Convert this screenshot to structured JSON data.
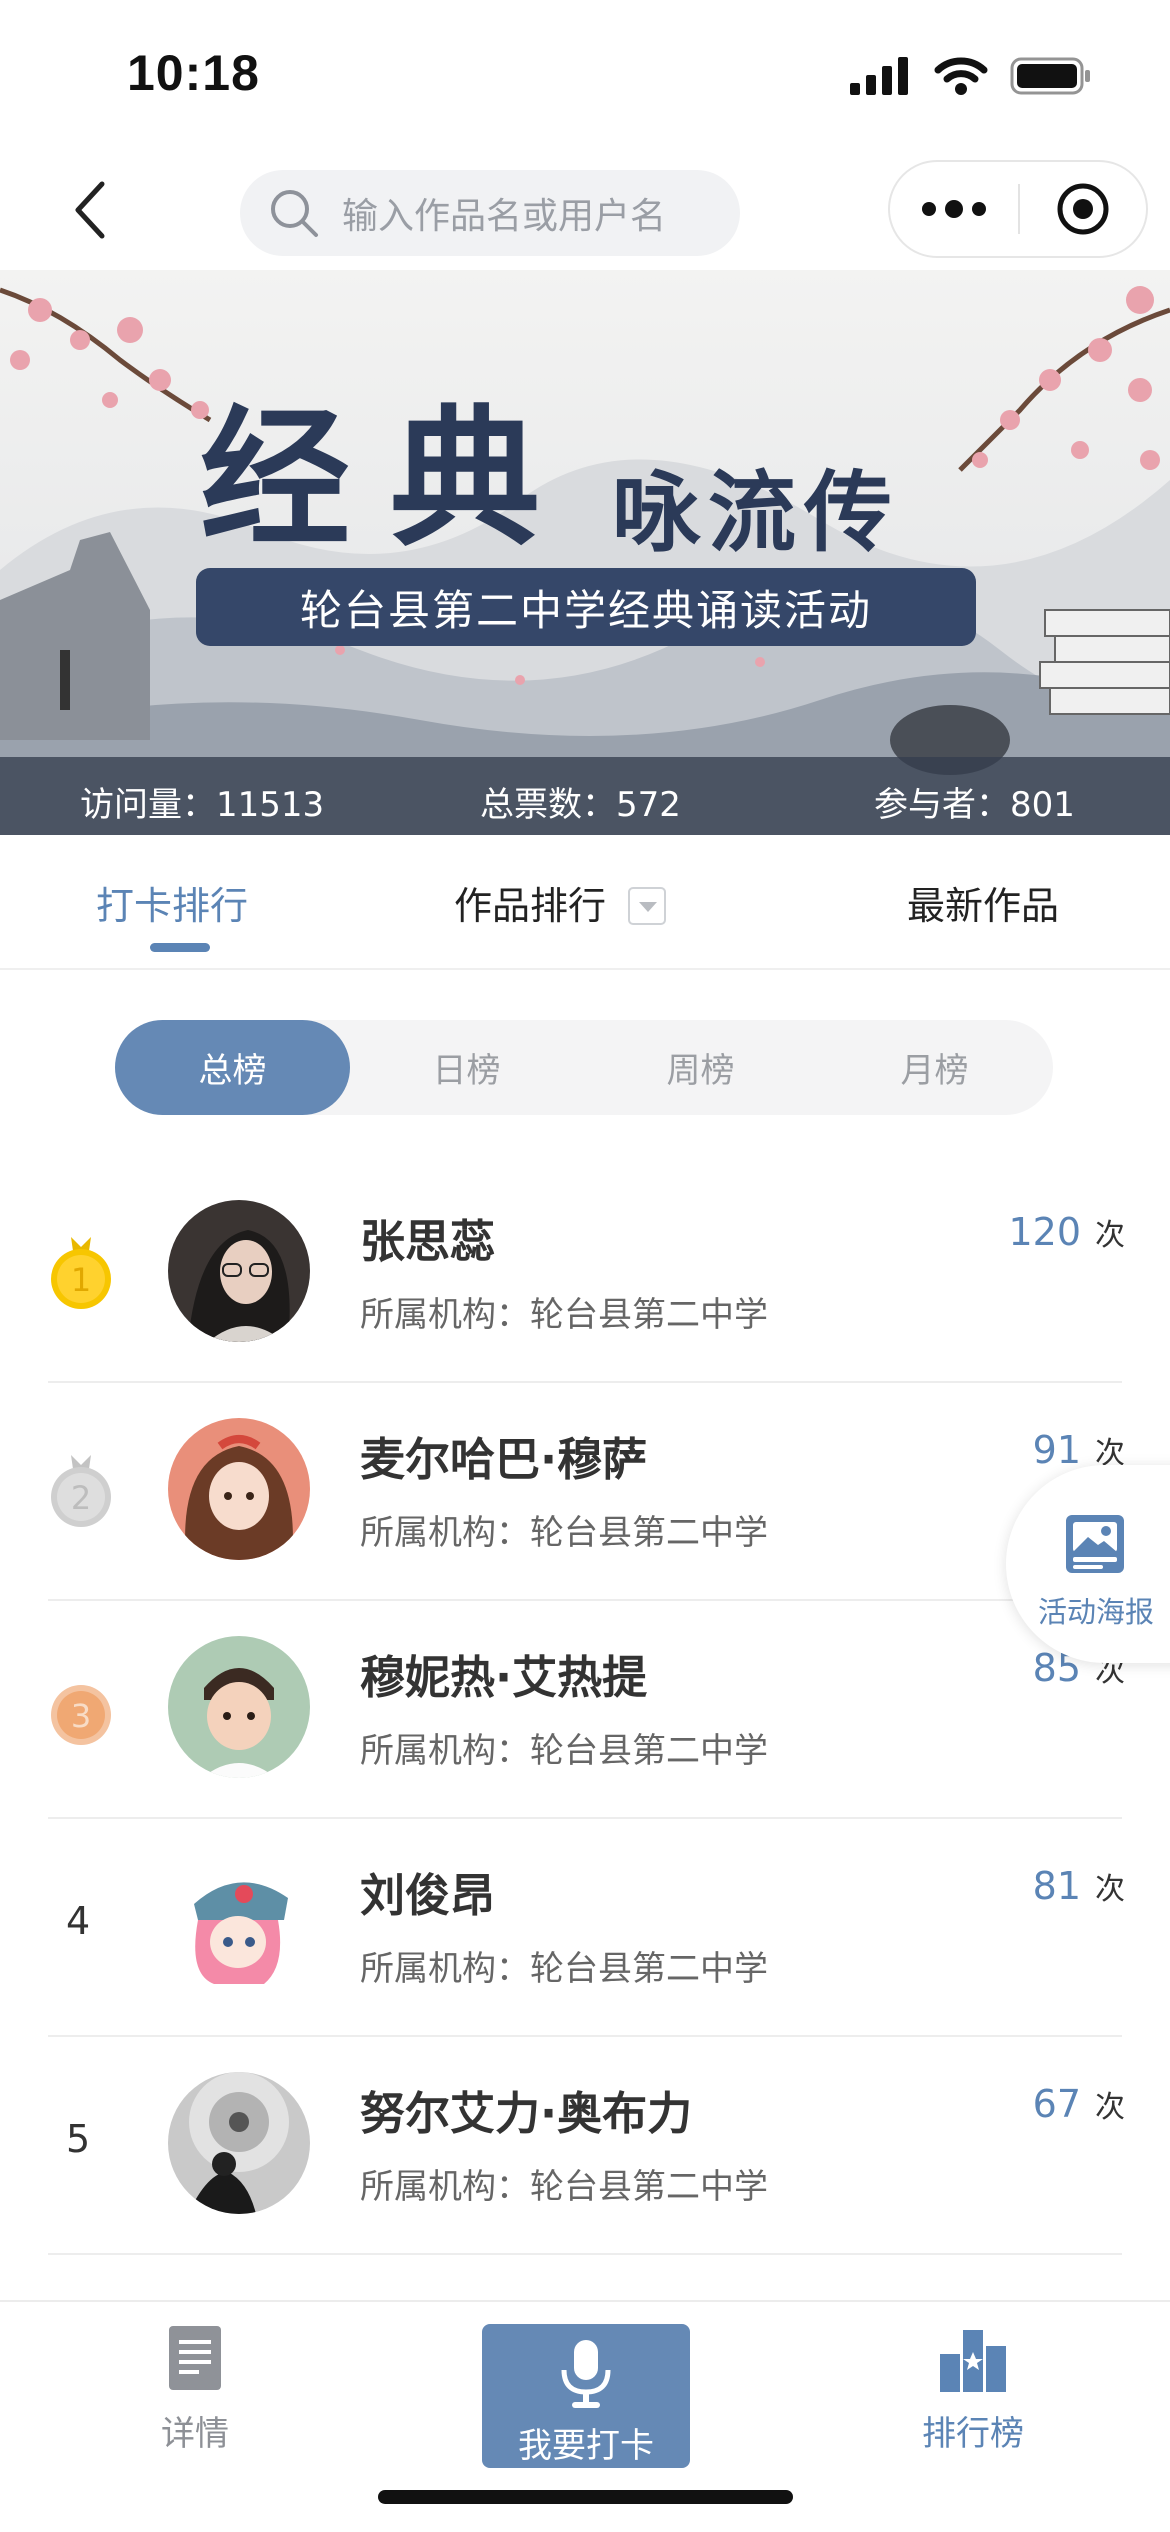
{
  "status_bar": {
    "time": "10:18"
  },
  "nav": {
    "search_placeholder": "输入作品名或用户名"
  },
  "banner": {
    "title_main": "经典",
    "title_sub": "咏流传",
    "subtitle": "轮台县第二中学经典诵读活动",
    "stats": [
      {
        "label": "访问量：",
        "value": "11513"
      },
      {
        "label": "总票数：",
        "value": "572"
      },
      {
        "label": "参与者：",
        "value": "801"
      }
    ]
  },
  "tabs": [
    {
      "label": "打卡排行",
      "active": true
    },
    {
      "label": "作品排行",
      "active": false
    },
    {
      "label": "最新作品",
      "active": false
    }
  ],
  "segments": [
    {
      "label": "总榜",
      "active": true
    },
    {
      "label": "日榜",
      "active": false
    },
    {
      "label": "周榜",
      "active": false
    },
    {
      "label": "月榜",
      "active": false
    }
  ],
  "ranking": [
    {
      "rank": "1",
      "name": "张思蕊",
      "org": "所属机构：轮台县第二中学",
      "count": "120",
      "unit": "次",
      "medal": "gold"
    },
    {
      "rank": "2",
      "name": "麦尔哈巴·穆萨",
      "org": "所属机构：轮台县第二中学",
      "count": "91",
      "unit": "次",
      "medal": "silver"
    },
    {
      "rank": "3",
      "name": "穆妮热·艾热提",
      "org": "所属机构：轮台县第二中学",
      "count": "85",
      "unit": "次",
      "medal": "bronze"
    },
    {
      "rank": "4",
      "name": "刘俊昂",
      "org": "所属机构：轮台县第二中学",
      "count": "81",
      "unit": "次",
      "medal": ""
    },
    {
      "rank": "5",
      "name": "努尔艾力·奥布力",
      "org": "所属机构：轮台县第二中学",
      "count": "67",
      "unit": "次",
      "medal": ""
    }
  ],
  "floating": {
    "label": "活动海报",
    "icon": "poster-image-icon"
  },
  "bottom_bar": [
    {
      "label": "详情",
      "icon": "document-icon"
    },
    {
      "label": "我要打卡",
      "icon": "microphone-icon"
    },
    {
      "label": "排行榜",
      "icon": "ranking-bars-icon"
    }
  ],
  "colors": {
    "accent": "#5b84b5",
    "segment_active": "#6589b5",
    "banner_pill": "#354769"
  }
}
